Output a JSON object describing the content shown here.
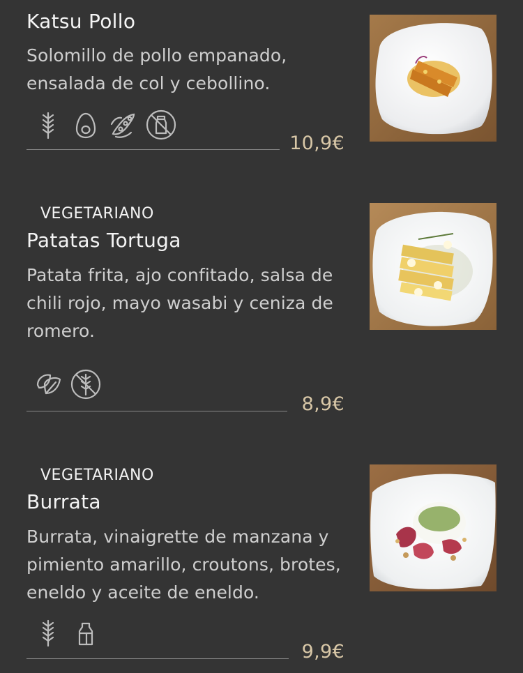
{
  "menu": {
    "items": [
      {
        "tag": "",
        "title": "Katsu Pollo",
        "description": "Solomillo de pollo empanado, ensalada de col y cebollino.",
        "allergen_icons": [
          "gluten-icon",
          "egg-icon",
          "soy-icon",
          "no-lactose-icon"
        ],
        "price": "10,9€"
      },
      {
        "tag": "VEGETARIANO",
        "title": "Patatas Tortuga",
        "description": "Patata frita, ajo confitado, salsa de chili rojo, mayo wasabi y ceniza de romero.",
        "allergen_icons": [
          "vegan-leaf-icon",
          "gluten-free-icon"
        ],
        "price": "8,9€"
      },
      {
        "tag": "VEGETARIANO",
        "title": "Burrata",
        "description": "Burrata, vinaigrette de manzana y pimiento amarillo, croutons, brotes, eneldo y aceite de eneldo.",
        "allergen_icons": [
          "gluten-icon",
          "milk-icon"
        ],
        "price": "9,9€"
      }
    ]
  },
  "colors": {
    "background": "#343434",
    "price": "#d8c7a7",
    "icon_stroke": "#bdbdbd"
  }
}
